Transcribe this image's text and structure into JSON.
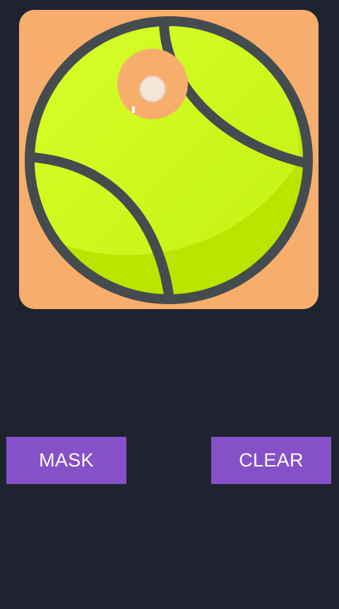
{
  "colors": {
    "screen_background": "#1f2330",
    "canvas_background": "#f7ae6c",
    "ball_light": "#d4ff1e",
    "ball_dark": "#b6e400",
    "seam": "#444b4e",
    "button": "#8550c8",
    "button_text": "#ffffff",
    "brush_cursor": "#f3d5bd"
  },
  "canvas": {
    "image_icon": "tennis-ball-icon",
    "brush_icon": "brush-cursor-icon"
  },
  "buttons": {
    "mask_label": "MASK",
    "clear_label": "CLEAR"
  }
}
